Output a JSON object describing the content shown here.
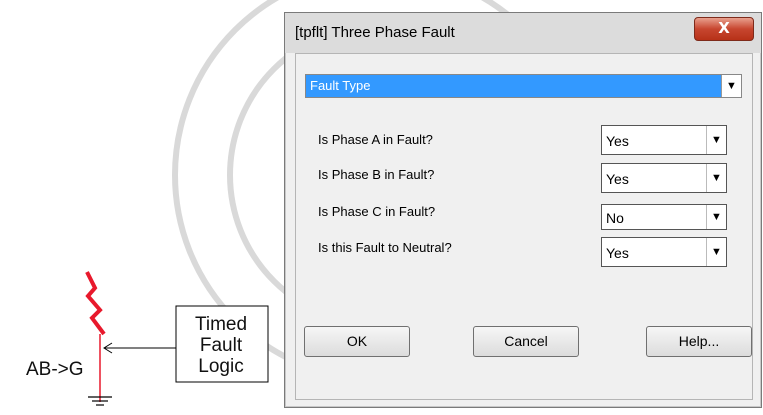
{
  "schematic": {
    "fault_label": "AB->G",
    "block_lines": [
      "Timed",
      "Fault",
      "Logic"
    ]
  },
  "dialog": {
    "title": "[tpflt] Three Phase Fault",
    "close_glyph": "X",
    "section": "Fault Type",
    "rows": [
      {
        "label": "Is Phase A in Fault?",
        "value": "Yes"
      },
      {
        "label": "Is Phase B in Fault?",
        "value": "Yes"
      },
      {
        "label": "Is Phase C in Fault?",
        "value": "No"
      },
      {
        "label": "Is this Fault to Neutral?",
        "value": "Yes"
      }
    ],
    "buttons": {
      "ok": "OK",
      "cancel": "Cancel",
      "help": "Help..."
    }
  },
  "colors": {
    "accent": "#3399ff",
    "fault_red": "#e8192c",
    "close_red": "#c7462f"
  }
}
